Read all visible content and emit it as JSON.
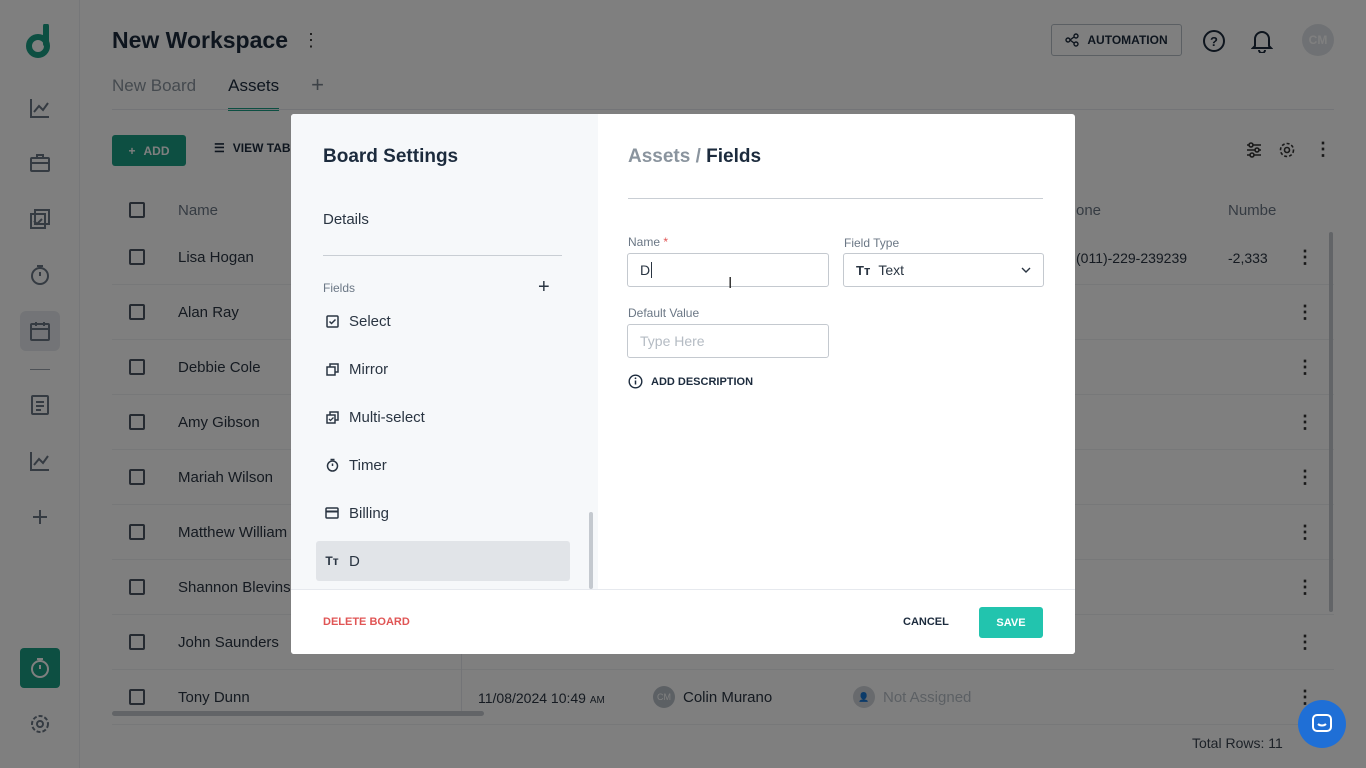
{
  "workspace": {
    "title": "New Workspace"
  },
  "tabs": [
    {
      "label": "New Board"
    },
    {
      "label": "Assets"
    }
  ],
  "header": {
    "automation_label": "AUTOMATION",
    "avatar_initials": "CM"
  },
  "toolbar": {
    "add_label": "ADD",
    "view_label": "VIEW TAB"
  },
  "table": {
    "headers": [
      "Name",
      "one",
      "Numbe"
    ],
    "rows": [
      {
        "name": "Lisa Hogan",
        "phone": "(011)-229-239239",
        "number": "-2,333"
      },
      {
        "name": "Alan Ray"
      },
      {
        "name": "Debbie Cole"
      },
      {
        "name": "Amy Gibson"
      },
      {
        "name": "Mariah Wilson"
      },
      {
        "name": "Matthew William"
      },
      {
        "name": "Shannon Blevins"
      },
      {
        "name": "John Saunders"
      },
      {
        "name": "Tony Dunn",
        "date": "11/08/2024 10:49",
        "date_suffix": "AM",
        "owner": "Colin Murano",
        "owner_initials": "CM",
        "assign": "Not Assigned"
      }
    ],
    "total_rows": "Total Rows: 11"
  },
  "modal": {
    "title": "Board Settings",
    "details_label": "Details",
    "fields_label": "Fields",
    "field_items": [
      {
        "label": "Select",
        "icon": "checkbox-icon"
      },
      {
        "label": "Mirror",
        "icon": "mirror-icon"
      },
      {
        "label": "Multi-select",
        "icon": "multi-select-icon"
      },
      {
        "label": "Timer",
        "icon": "timer-icon"
      },
      {
        "label": "Billing",
        "icon": "card-icon"
      },
      {
        "label": "D",
        "icon": "text-type-icon"
      }
    ],
    "breadcrumb_parent": "Assets /",
    "breadcrumb_current": "Fields",
    "name_label": "Name",
    "name_required": "*",
    "name_value": "D",
    "field_type_label": "Field Type",
    "field_type_value": "Text",
    "default_value_label": "Default Value",
    "default_value_placeholder": "Type Here",
    "add_description_label": "ADD DESCRIPTION",
    "delete_board_label": "DELETE BOARD",
    "cancel_label": "CANCEL",
    "save_label": "SAVE"
  },
  "colors": {
    "brand": "#1a9e85",
    "save": "#22c4ae",
    "danger": "#e05555"
  }
}
